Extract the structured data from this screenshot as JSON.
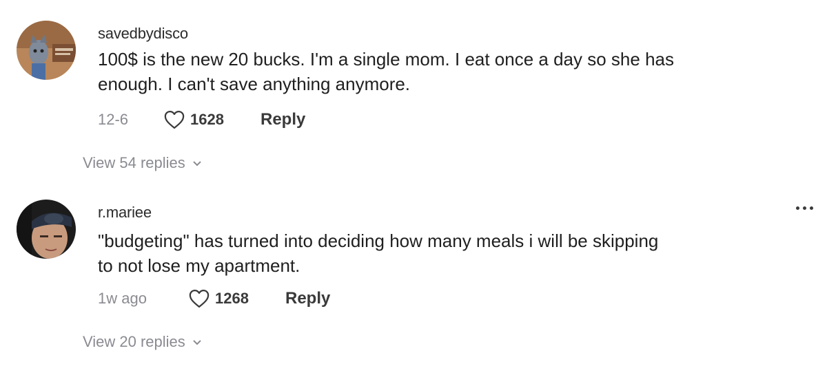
{
  "comments": [
    {
      "username": "savedbydisco",
      "text_line1": "100$ is the new 20 bucks. I'm a single mom. I eat once a day so she has",
      "text_line2": "enough. I can't save anything anymore.",
      "date": "12-6",
      "likes": "1628",
      "reply_label": "Reply",
      "view_replies": "View 54 replies"
    },
    {
      "username": "r.mariee",
      "text_line1": "\"budgeting\" has turned into deciding how many meals i will be skipping",
      "text_line2": "to not lose my apartment.",
      "date": "1w ago",
      "likes": "1268",
      "reply_label": "Reply",
      "view_replies": "View 20 replies"
    }
  ],
  "icons": {
    "like": "heart-outline-icon",
    "more": "more-horizontal-icon",
    "expand": "chevron-down-icon"
  },
  "colors": {
    "text": "#1f1f1f",
    "muted": "#8a8b91"
  }
}
